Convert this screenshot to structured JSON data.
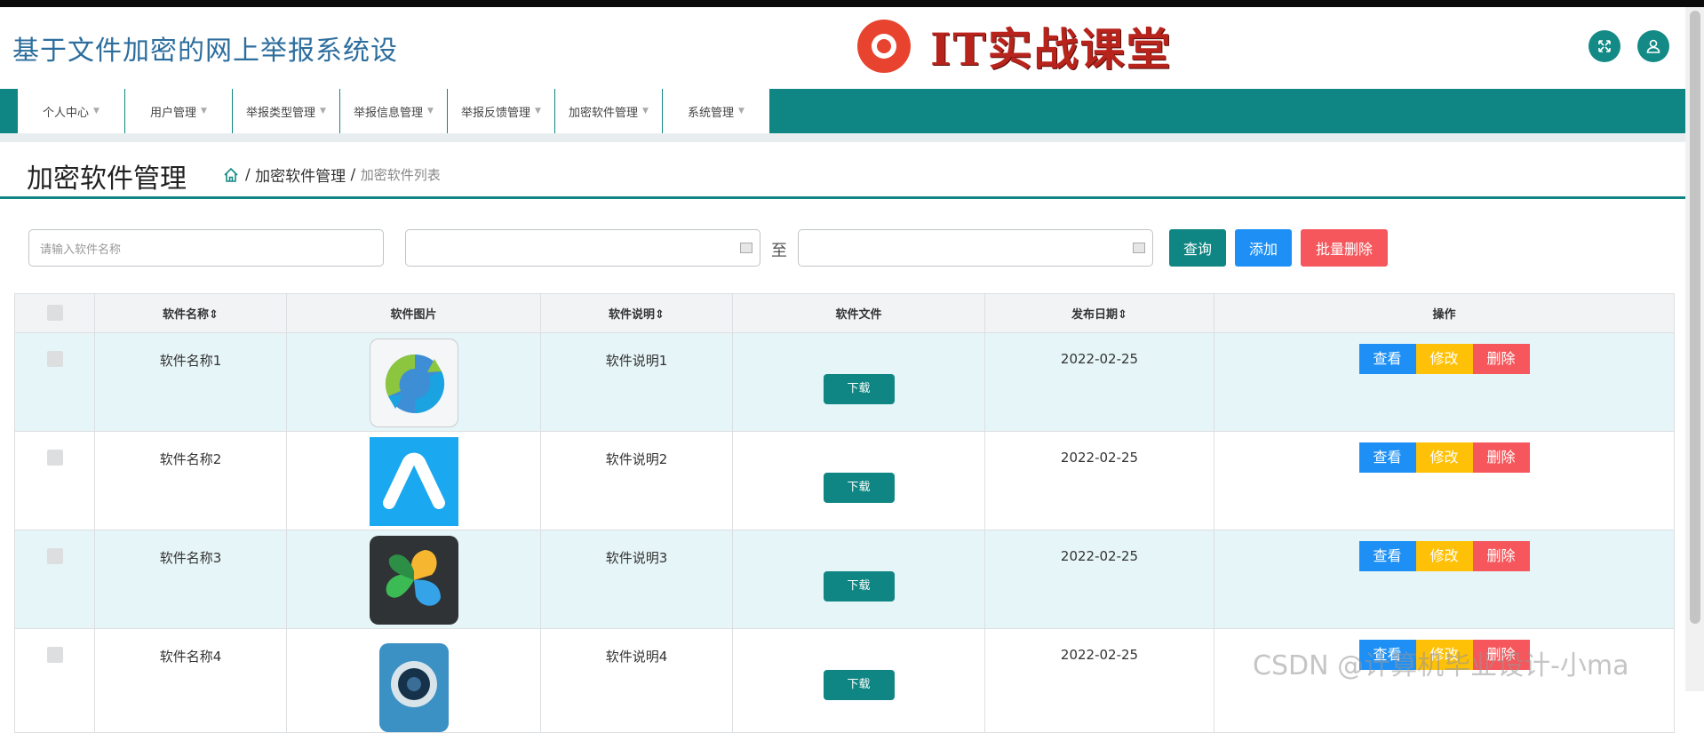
{
  "header": {
    "site_title": "基于文件加密的网上举报系统设",
    "logo_text": "IT实战课堂",
    "icons": [
      "fullscreen-icon",
      "user-icon"
    ]
  },
  "nav": {
    "items": [
      {
        "label": "个人中心"
      },
      {
        "label": "用户管理"
      },
      {
        "label": "举报类型管理"
      },
      {
        "label": "举报信息管理"
      },
      {
        "label": "举报反馈管理"
      },
      {
        "label": "加密软件管理"
      },
      {
        "label": "系统管理"
      }
    ]
  },
  "page": {
    "title": "加密软件管理",
    "breadcrumb": {
      "sep": "/",
      "section": "加密软件管理",
      "current": "加密软件列表"
    }
  },
  "filters": {
    "name_placeholder": "请输入软件名称",
    "range_sep": "至",
    "query_label": "查询",
    "add_label": "添加",
    "batch_delete_label": "批量删除"
  },
  "table": {
    "headers": {
      "name": "软件名称",
      "image": "软件图片",
      "desc": "软件说明",
      "file": "软件文件",
      "date": "发布日期",
      "actions": "操作"
    },
    "sort_glyph": "⇕",
    "download_label": "下载",
    "view_label": "查看",
    "edit_label": "修改",
    "delete_label": "删除",
    "rows": [
      {
        "name": "软件名称1",
        "desc": "软件说明1",
        "date": "2022-02-25",
        "icon": "sync-app-icon"
      },
      {
        "name": "软件名称2",
        "desc": "软件说明2",
        "date": "2022-02-25",
        "icon": "letter-a-app-icon"
      },
      {
        "name": "软件名称3",
        "desc": "软件说明3",
        "date": "2022-02-25",
        "icon": "pinwheel-app-icon"
      },
      {
        "name": "软件名称4",
        "desc": "软件说明4",
        "date": "2022-02-25",
        "icon": "camera-app-icon"
      }
    ]
  },
  "colors": {
    "teal": "#0f8683",
    "blue": "#1e90f5",
    "yellow": "#ffc107",
    "red": "#f5575c"
  },
  "watermark": "CSDN @计算机毕业设计-小ma"
}
